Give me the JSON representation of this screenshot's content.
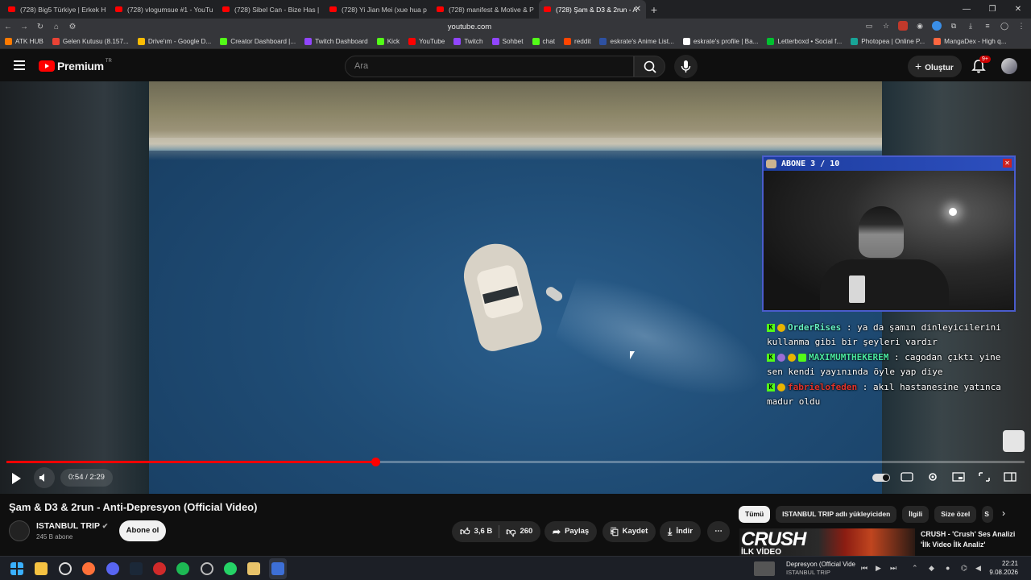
{
  "browser": {
    "tabs": [
      {
        "title": "(728) Big5 Türkiye | Erkek Haz"
      },
      {
        "title": "(728) vlogumsue #1 - YouTube"
      },
      {
        "title": "(728) Sibel Can - Bize Has | Jah"
      },
      {
        "title": "(728) Yi Jian Mei (xue hua piao"
      },
      {
        "title": "(728) manifest & Motive & Pa"
      },
      {
        "title": "(728) Şam & D3 & 2run - A"
      }
    ],
    "url": "youtube.com",
    "bookmarks": [
      {
        "label": "ATK HUB",
        "color": "#ff7a00"
      },
      {
        "label": "Gelen Kutusu (8.157...",
        "color": "#ea4335"
      },
      {
        "label": "Drive'ım - Google D...",
        "color": "#fbbc04"
      },
      {
        "label": "Creator Dashboard |...",
        "color": "#53fc18"
      },
      {
        "label": "Twitch Dashboard",
        "color": "#9146ff"
      },
      {
        "label": "Kick",
        "color": "#53fc18"
      },
      {
        "label": "YouTube",
        "color": "#ff0000"
      },
      {
        "label": "Twitch",
        "color": "#9146ff"
      },
      {
        "label": "Sohbet",
        "color": "#9146ff"
      },
      {
        "label": "chat",
        "color": "#53fc18"
      },
      {
        "label": "reddit",
        "color": "#ff4500"
      },
      {
        "label": "eskrate's Anime List...",
        "color": "#2e51a2"
      },
      {
        "label": "eskrate's profile | Ba...",
        "color": "#ffffff"
      },
      {
        "label": "Letterboxd • Social f...",
        "color": "#00c030"
      },
      {
        "label": "Photopea | Online P...",
        "color": "#18a497"
      },
      {
        "label": "MangaDex - High q...",
        "color": "#ff6740"
      }
    ]
  },
  "header": {
    "logo_text": "Premium",
    "logo_region": "TR",
    "search_placeholder": "Ara",
    "create_label": "Oluştur",
    "notif_badge": "9+"
  },
  "player": {
    "time": "0:54 / 2:29",
    "progress": 0.362
  },
  "overlay": {
    "cam_title": "ABONE 3 / 10",
    "chat": [
      {
        "user": "OrderRises",
        "text": " : ya da şamın dinleyicilerini kullanma gibi bir şeyleri vardır"
      },
      {
        "user": "MAXIMUMTHEKEREM",
        "text": " : cagodan çıktı yine sen kendi yayınında öyle yap diye"
      },
      {
        "user": "fabrielofeden",
        "text": " : akıl hastanesine yatınca madur oldu"
      }
    ]
  },
  "video": {
    "title": "Şam & D3 & 2run - Anti-Depresyon (Official Video)",
    "channel": "ISTANBUL TRIP",
    "subscribers": "245 B abone",
    "subscribe_label": "Abone ol",
    "likes": "3,6 B",
    "dislikes": "260",
    "share_label": "Paylaş",
    "save_label": "Kaydet",
    "download_label": "İndir"
  },
  "sidebar": {
    "filters": [
      "Tümü",
      "ISTANBUL TRIP adlı yükleyiciden",
      "İlgili",
      "Size özel",
      "S"
    ],
    "rec_thumb_big": "CRUSH",
    "rec_thumb_sub": "İLK VİDEO",
    "rec_title": "CRUSH - 'Crush' Ses Analizi 'İlk Video İlk Analiz'"
  },
  "taskbar": {
    "media_title": "Depresyon (Official Vide",
    "media_artist": "ISTANBUL TRIP",
    "time": "22:21",
    "date": "9.08.2026"
  }
}
